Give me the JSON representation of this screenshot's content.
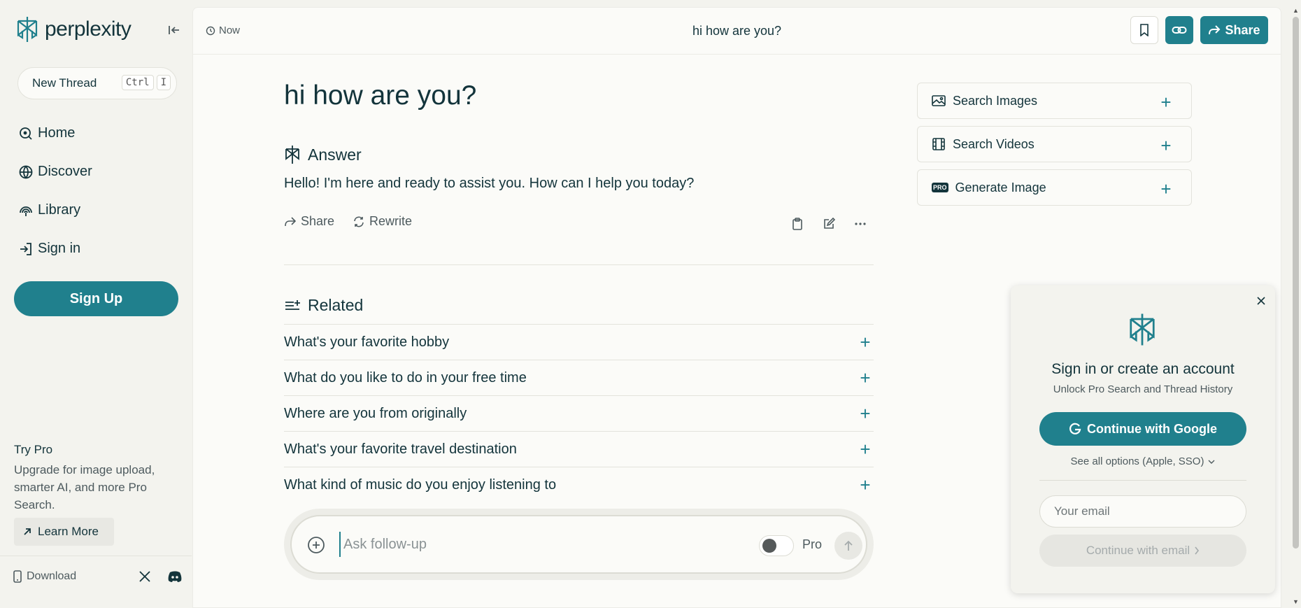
{
  "sidebar": {
    "brand": "perplexity",
    "new_thread": "New Thread",
    "shortcut_keys": [
      "Ctrl",
      "I"
    ],
    "nav": [
      {
        "label": "Home",
        "icon": "home-search-icon"
      },
      {
        "label": "Discover",
        "icon": "globe-icon"
      },
      {
        "label": "Library",
        "icon": "library-icon"
      },
      {
        "label": "Sign in",
        "icon": "sign-in-icon"
      }
    ],
    "signup": "Sign Up",
    "try_pro_title": "Try Pro",
    "try_pro_desc": "Upgrade for image upload, smarter AI, and more Pro Search.",
    "learn_more": "Learn More",
    "download": "Download"
  },
  "topbar": {
    "time": "Now",
    "title": "hi how are you?",
    "share": "Share"
  },
  "thread": {
    "question": "hi how are you?",
    "answer_heading": "Answer",
    "answer": "Hello! I'm here and ready to assist you. How can I help you today?",
    "actions": {
      "share": "Share",
      "rewrite": "Rewrite"
    },
    "related_heading": "Related",
    "related": [
      "What's your favorite hobby",
      "What do you like to do in your free time",
      "Where are you from originally",
      "What's your favorite travel destination",
      "What kind of music do you enjoy listening to"
    ],
    "followup_placeholder": "Ask follow-up",
    "pro_label": "Pro",
    "pro_enabled": false
  },
  "side_panel": {
    "items": [
      {
        "label": "Search Images"
      },
      {
        "label": "Search Videos"
      },
      {
        "label": "Generate Image",
        "badge": "PRO"
      }
    ]
  },
  "signin_popover": {
    "title": "Sign in or create an account",
    "subtitle": "Unlock Pro Search and Thread History",
    "google": "Continue with Google",
    "all_options": "See all options (Apple, SSO)",
    "email_placeholder": "Your email",
    "email_button": "Continue with email"
  },
  "colors": {
    "accent": "#20808d",
    "text": "#13343b",
    "background": "#f3f3ee"
  }
}
